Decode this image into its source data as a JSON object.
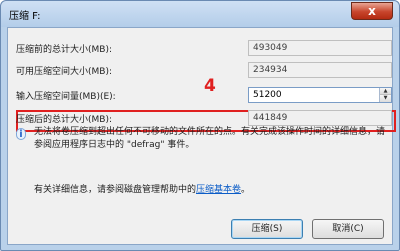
{
  "window": {
    "title": "压缩 F:",
    "close_label": "x"
  },
  "fields": [
    {
      "label": "压缩前的总计大小(MB):",
      "value": "493049"
    },
    {
      "label": "可用压缩空间大小(MB):",
      "value": "234934"
    },
    {
      "label": "输入压缩空间量(MB)(E):",
      "value": "51200"
    },
    {
      "label": "压缩后的总计大小(MB):",
      "value": "441849"
    }
  ],
  "annotation": {
    "step_number": "4",
    "highlight_color": "#e02020"
  },
  "info": {
    "icon": "info-icon",
    "icon_glyph": "i",
    "text": "无法将卷压缩到超出任何不可移动的文件所在的点。有关完成该操作时间的详细信息，请参阅应用程序日志中的 \"defrag\" 事件。"
  },
  "help": {
    "text": "有关详细信息，请参阅磁盘管理帮助中的",
    "link": "压缩基本卷",
    "suffix": "。"
  },
  "buttons": {
    "compress": "压缩(S)",
    "cancel": "取消(C)"
  },
  "spinner": {
    "up": "▲",
    "down": "▼"
  }
}
